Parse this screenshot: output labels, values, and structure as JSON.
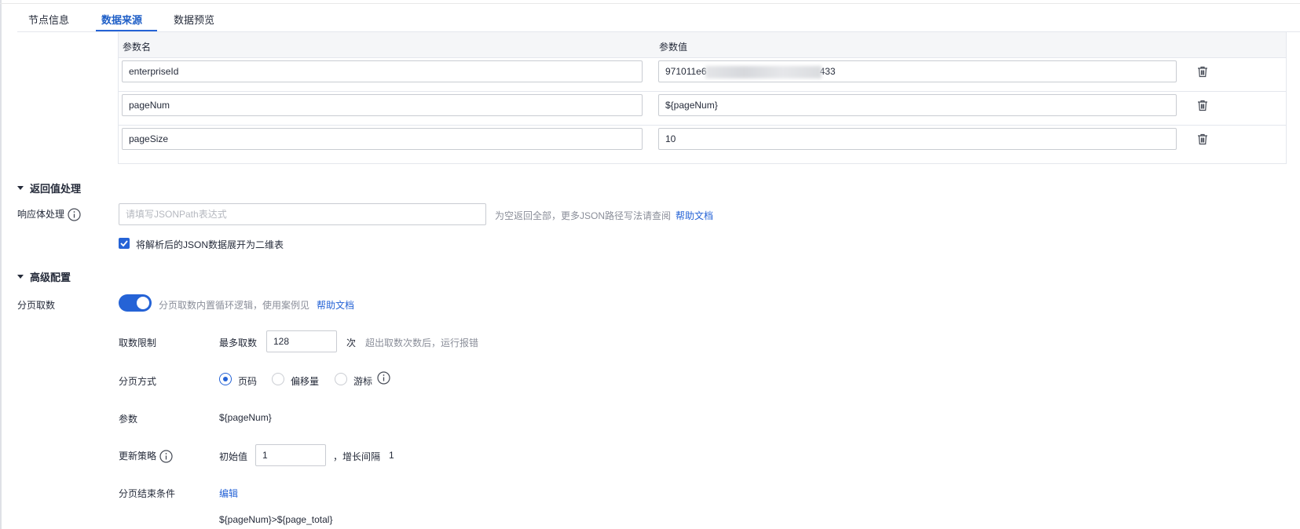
{
  "tabs": [
    {
      "label": "节点信息",
      "active": false
    },
    {
      "label": "数据来源",
      "active": true
    },
    {
      "label": "数据预览",
      "active": false
    }
  ],
  "params_table": {
    "headers": {
      "name": "参数名",
      "value": "参数值"
    },
    "rows": [
      {
        "name": "enterpriseId",
        "value_prefix": "971011e6",
        "value_suffix": "433"
      },
      {
        "name": "pageNum",
        "value": "${pageNum}"
      },
      {
        "name": "pageSize",
        "value": "10"
      }
    ]
  },
  "response_section": {
    "title": "返回值处理",
    "body_label": "响应体处理",
    "jsonpath_placeholder": "请填写JSONPath表达式",
    "hint": "为空返回全部，更多JSON路径写法请查阅",
    "help_link": "帮助文档",
    "flatten_checkbox": {
      "label": "将解析后的JSON数据展开为二维表",
      "checked": true
    }
  },
  "advanced_section": {
    "title": "高级配置",
    "paging_label": "分页取数",
    "paging_enabled": true,
    "paging_hint": "分页取数内置循环逻辑，使用案例见",
    "paging_help_link": "帮助文档",
    "limit": {
      "label": "取数限制",
      "max_label": "最多取数",
      "max_value": "128",
      "unit": "次",
      "hint": "超出取数次数后，运行报错"
    },
    "paging_mode": {
      "label": "分页方式",
      "options": [
        {
          "label": "页码",
          "checked": true
        },
        {
          "label": "偏移量",
          "checked": false
        },
        {
          "label": "游标",
          "checked": false
        }
      ]
    },
    "param": {
      "label": "参数",
      "value": "${pageNum}"
    },
    "update_strategy": {
      "label": "更新策略",
      "initial_label": "初始值",
      "initial_value": "1",
      "step_label": "，增长间隔",
      "step_value": "1"
    },
    "end_condition": {
      "label": "分页结束条件",
      "edit_link": "编辑",
      "expression": "${pageNum}>${page_total}"
    }
  },
  "colors": {
    "accent": "#2563d6",
    "border": "#c9ccd2",
    "text": "#252b3a",
    "hint": "#8a8e99"
  }
}
